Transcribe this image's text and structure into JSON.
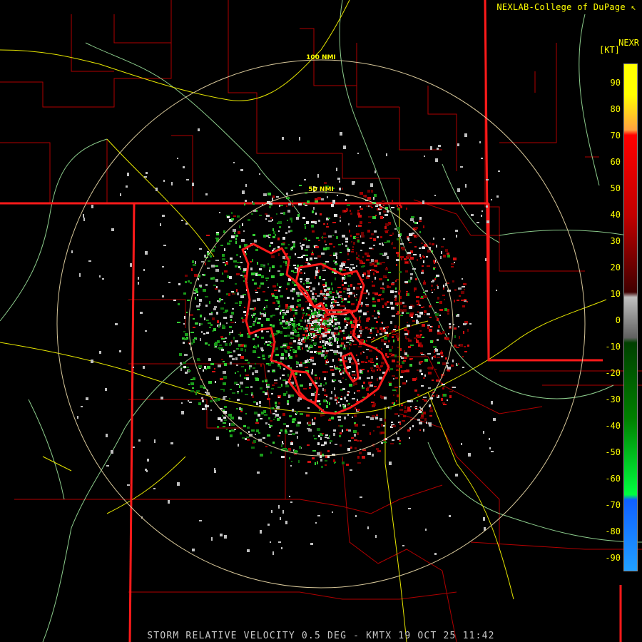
{
  "header": {
    "credit": "NEXLAB-College of DuPage",
    "product": "NEXR",
    "unit": "[KT]"
  },
  "rings": [
    {
      "label": "100 NMI"
    },
    {
      "label": "50 NMI"
    }
  ],
  "legend": {
    "ticks": [
      "90",
      "80",
      "70",
      "60",
      "50",
      "40",
      "30",
      "20",
      "10",
      "0",
      "-10",
      "-20",
      "-30",
      "-40",
      "-50",
      "-60",
      "-70",
      "-80",
      "-90"
    ],
    "colors": {
      "top": "#ffff00",
      "orange": "#ffa040",
      "red": "#ff0000",
      "dark_red": "#400000",
      "gray": "#c0c0c0",
      "dark_green": "#004000",
      "green": "#00ff40",
      "blue": "#1060ff",
      "light_blue": "#20a0ff"
    }
  },
  "footer": "STORM RELATIVE VELOCITY 0.5 DEG - KMTX 19 OCT 25 11:42",
  "map_colors": {
    "state_border": "#ff1a1a",
    "county_border": "#b00000",
    "highway": "#e6e600",
    "river": "#8ccc8c",
    "ring": "#d8c89a",
    "warning_polygon": "#ff1a1a"
  }
}
